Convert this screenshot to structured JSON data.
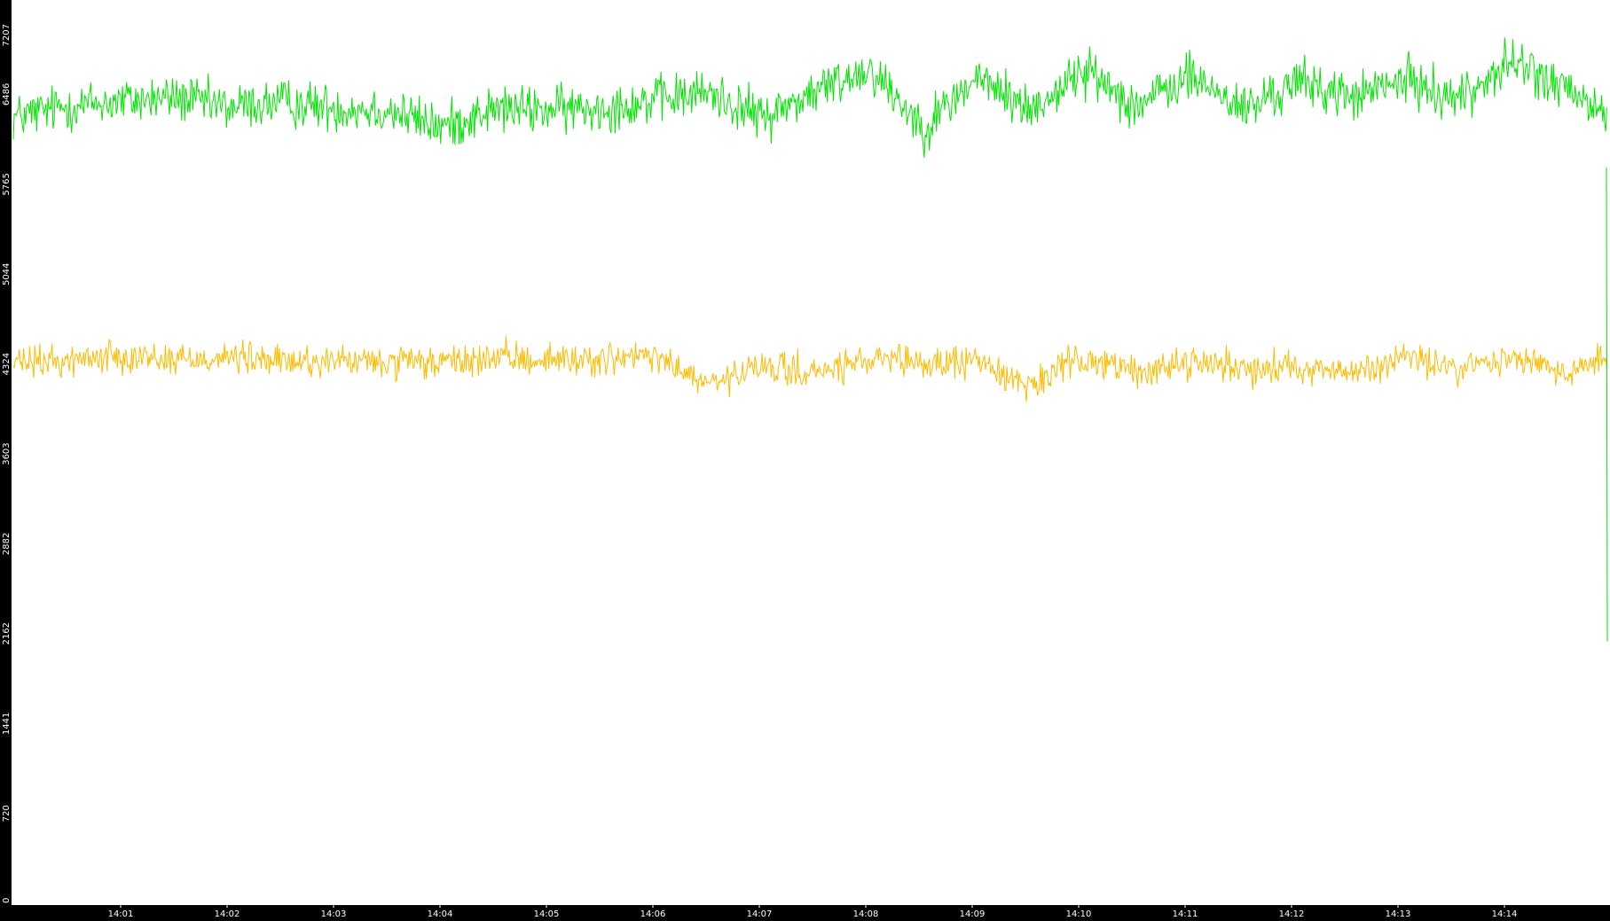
{
  "chart_data": {
    "type": "line",
    "title": "",
    "xlabel": "",
    "ylabel": "",
    "ylim": [
      0,
      7207
    ],
    "grid": false,
    "legend": "none",
    "background": "#ffffff",
    "axis_color": "#000000",
    "axis_text_color": "#ffffff",
    "y_ticks": [
      "0",
      "720",
      "1441",
      "2162",
      "2882",
      "3603",
      "4324",
      "5044",
      "5765",
      "6486",
      "7207"
    ],
    "x_ticks": [
      "14:01",
      "14:02",
      "14:03",
      "14:04",
      "14:05",
      "14:06",
      "14:07",
      "14:08",
      "14:09",
      "14:10",
      "14:11",
      "14:12",
      "14:13",
      "14:14"
    ],
    "x_range": [
      "14:00:05",
      "14:14:58"
    ],
    "series": [
      {
        "color": "#00e600",
        "x_seconds_from_start": [
          0,
          30,
          60,
          90,
          120,
          150,
          180,
          210,
          240,
          270,
          300,
          330,
          360,
          390,
          420,
          450,
          480,
          510,
          540,
          570,
          600,
          630,
          660,
          690,
          720,
          750,
          780,
          810,
          840,
          870,
          893
        ],
        "values": [
          6300,
          6390,
          6430,
          6460,
          6380,
          6420,
          6380,
          6360,
          6220,
          6370,
          6360,
          6380,
          6440,
          6500,
          6300,
          6510,
          6700,
          6220,
          6620,
          6360,
          6680,
          6400,
          6630,
          6360,
          6590,
          6460,
          6600,
          6450,
          6750,
          6520,
          6300
        ]
      },
      {
        "color": "#ffbb00",
        "x_seconds_from_start": [
          0,
          30,
          60,
          90,
          120,
          150,
          180,
          210,
          240,
          270,
          300,
          330,
          360,
          390,
          420,
          450,
          480,
          510,
          540,
          570,
          600,
          630,
          660,
          690,
          720,
          750,
          780,
          810,
          840,
          870,
          893
        ],
        "values": [
          4330,
          4350,
          4400,
          4360,
          4380,
          4340,
          4350,
          4330,
          4330,
          4370,
          4360,
          4360,
          4380,
          4150,
          4300,
          4250,
          4350,
          4320,
          4350,
          4150,
          4380,
          4250,
          4350,
          4290,
          4310,
          4240,
          4380,
          4280,
          4380,
          4250,
          4390
        ]
      }
    ]
  }
}
